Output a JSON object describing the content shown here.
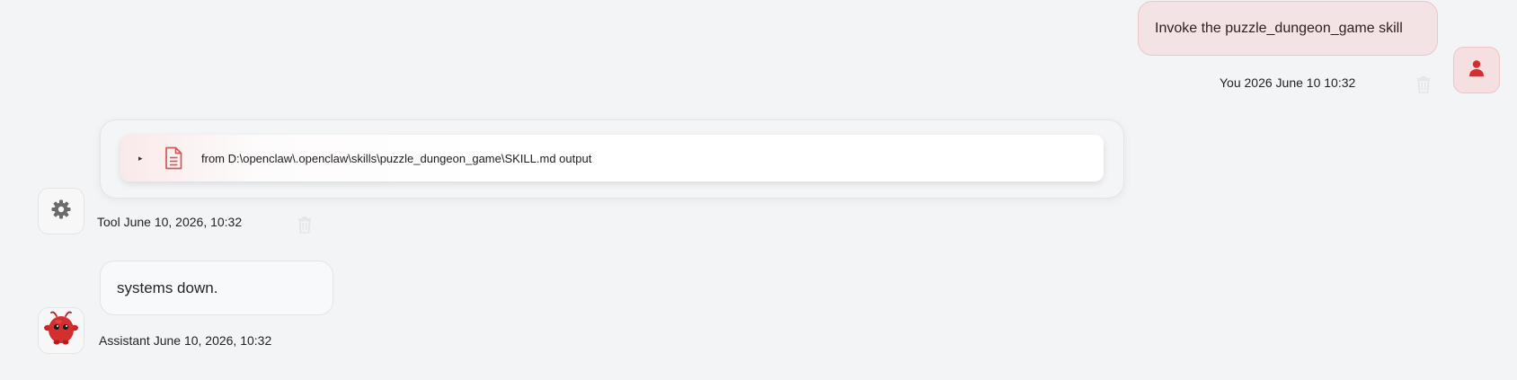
{
  "messages": {
    "user": {
      "text": "Invoke the puzzle_dungeon_game skill",
      "meta": "You 2026 June 10 10:32",
      "avatar_icon": "person-icon",
      "delete_icon": "trash-icon"
    },
    "tool": {
      "summary": "from D:\\openclaw\\.openclaw\\skills\\puzzle_dungeon_game\\SKILL.md output",
      "caret": "▸",
      "file_icon": "document-icon",
      "meta": "Tool June 10, 2026, 10:32",
      "avatar_icon": "gear-icon",
      "delete_icon": "trash-icon"
    },
    "assistant": {
      "text": "systems down.",
      "meta": "Assistant June 10, 2026, 10:32",
      "avatar_icon": "red-mascot-icon"
    }
  },
  "colors": {
    "background": "#f3f4f6",
    "accent": "#d32f2f",
    "user_bubble": "#f3e3e5",
    "icon_gray": "#6b6b6b"
  }
}
